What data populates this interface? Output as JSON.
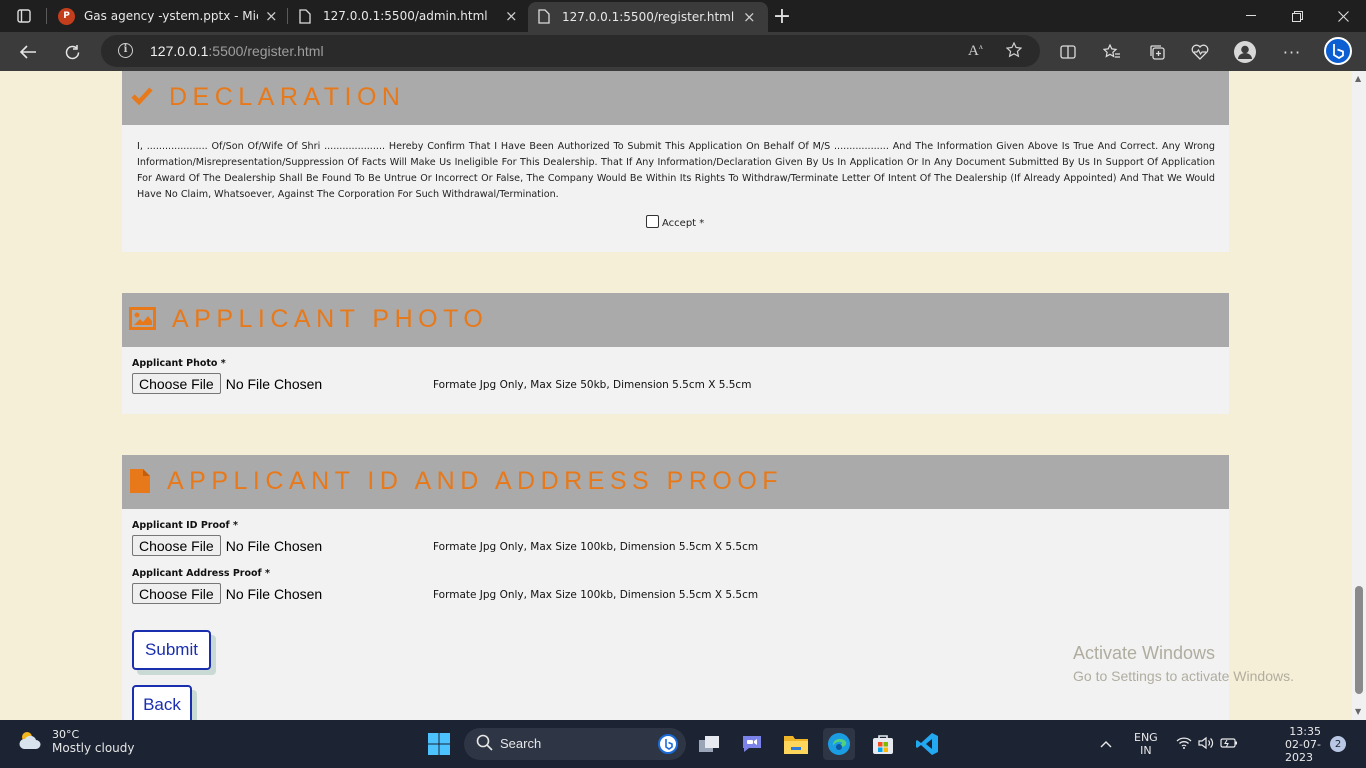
{
  "browser": {
    "tabs": [
      {
        "title": "Gas agency -ystem.pptx - Micros",
        "close": "×",
        "active": false
      },
      {
        "title": "127.0.0.1:5500/admin.html",
        "close": "×",
        "active": false
      },
      {
        "title": "127.0.0.1:5500/register.html",
        "close": "×",
        "active": true
      }
    ],
    "new_tab": "+",
    "address_host": "127.0.0.1",
    "address_path": ":5500/register.html"
  },
  "declaration": {
    "title": "DECLARATION",
    "text": "I, .................... Of/Son Of/Wife Of Shri .................... Hereby Confirm That I Have Been Authorized To Submit This Application On Behalf Of M/S .................. And The Information Given Above Is True And Correct. Any Wrong Information/Misrepresentation/Suppression Of Facts Will Make Us Ineligible For This Dealership. That If Any Information/Declaration Given By Us In Application Or In Any Document Submitted By Us In Support Of Application For Award Of The Dealership Shall Be Found To Be Untrue Or Incorrect Or False, The Company Would Be Within Its Rights To Withdraw/Terminate Letter Of Intent Of The Dealership (If Already Appointed) And That We Would Have No Claim, Whatsoever, Against The Corporation For Such Withdrawal/Termination.",
    "accept_label": "Accept *",
    "accept_checked": false
  },
  "photo": {
    "title": "APPLICANT PHOTO",
    "label": "Applicant Photo *",
    "choose": "Choose File",
    "status": "No File Chosen",
    "hint": "Formate Jpg Only, Max Size 50kb, Dimension 5.5cm X 5.5cm"
  },
  "proof": {
    "title": "APPLICANT ID AND ADDRESS PROOF",
    "id_label": "Applicant ID Proof *",
    "id_choose": "Choose File",
    "id_status": "No File Chosen",
    "id_hint": "Formate Jpg Only, Max Size 100kb, Dimension 5.5cm X 5.5cm",
    "addr_label": "Applicant Address Proof *",
    "addr_choose": "Choose File",
    "addr_status": "No File Chosen",
    "addr_hint": "Formate Jpg Only, Max Size 100kb, Dimension 5.5cm X 5.5cm"
  },
  "buttons": {
    "submit": "Submit",
    "back": "Back"
  },
  "watermark": {
    "line1": "Activate Windows",
    "line2": "Go to Settings to activate Windows."
  },
  "taskbar": {
    "temp": "30°C",
    "weather": "Mostly cloudy",
    "search": "Search",
    "lang1": "ENG",
    "lang2": "IN",
    "time": "13:35",
    "date": "02-07-2023",
    "notif_count": "2"
  },
  "colors": {
    "accent": "#e8791a",
    "button_border": "#1a2fb0",
    "page_bg": "#f6efd7",
    "section_header": "#aaaaaa"
  }
}
